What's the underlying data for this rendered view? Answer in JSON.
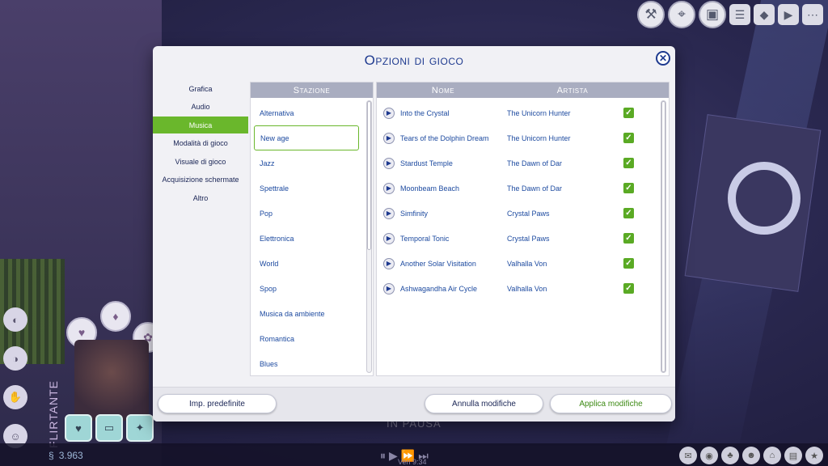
{
  "dialog": {
    "title": "Opzioni di gioco",
    "close_glyph": "✕"
  },
  "categories": [
    {
      "label": "Grafica",
      "active": false
    },
    {
      "label": "Audio",
      "active": false
    },
    {
      "label": "Musica",
      "active": true
    },
    {
      "label": "Modalità di gioco",
      "active": false
    },
    {
      "label": "Visuale di gioco",
      "active": false
    },
    {
      "label": "Acquisizione schermate",
      "active": false
    },
    {
      "label": "Altro",
      "active": false
    }
  ],
  "stations": {
    "header": "Stazione",
    "selected": "New age",
    "items": [
      "Alternativa",
      "New age",
      "Jazz",
      "Spettrale",
      "Pop",
      "Elettronica",
      "World",
      "Spop",
      "Musica da ambiente",
      "Romantica",
      "Blues"
    ]
  },
  "songs": {
    "header_name": "Nome",
    "header_artist": "Artista",
    "rows": [
      {
        "name": "Into the Crystal",
        "artist": "The Unicorn Hunter",
        "enabled": true
      },
      {
        "name": "Tears of the Dolphin Dream",
        "artist": "The Unicorn Hunter",
        "enabled": true
      },
      {
        "name": "Stardust Temple",
        "artist": "The Dawn of Dar",
        "enabled": true
      },
      {
        "name": "Moonbeam Beach",
        "artist": "The Dawn of Dar",
        "enabled": true
      },
      {
        "name": "Simfinity",
        "artist": "Crystal Paws",
        "enabled": true
      },
      {
        "name": "Temporal Tonic",
        "artist": "Crystal Paws",
        "enabled": true
      },
      {
        "name": "Another Solar Visitation",
        "artist": "Valhalla Von",
        "enabled": true
      },
      {
        "name": "Ashwagandha Air Cycle",
        "artist": "Valhalla Von",
        "enabled": true
      }
    ]
  },
  "footer": {
    "defaults_label": "Imp. predefinite",
    "cancel_label": "Annulla modifiche",
    "apply_label": "Applica modifiche"
  },
  "hud": {
    "funds": "3.963",
    "paused_text": "IN PAUSA",
    "week_text": "Ven 9:34",
    "mood_text": "FLIRTANTE",
    "top_icons": [
      "tools-icon",
      "map-icon",
      "photo-icon",
      "menu-icon"
    ],
    "colors": {
      "accent_green": "#6ab72c",
      "title_blue": "#1e3a8f",
      "header_gray": "#a9adc0"
    }
  }
}
